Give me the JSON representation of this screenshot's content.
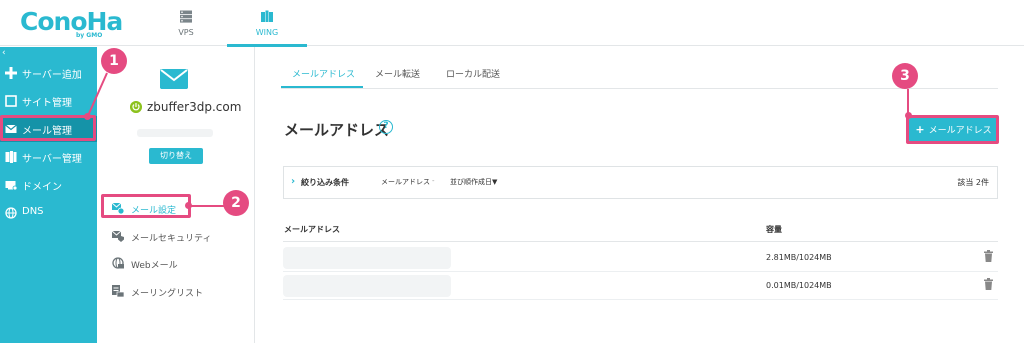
{
  "brand": {
    "logo_text": "ConoHa",
    "logo_sub": "by GMO"
  },
  "top_nav": [
    {
      "label": "VPS",
      "icon": "server-icon"
    },
    {
      "label": "WING",
      "icon": "wing-icon",
      "active": true
    }
  ],
  "sidebar": {
    "collapse_glyph": "‹",
    "items": [
      {
        "label": "サーバー追加",
        "icon": "plus-icon"
      },
      {
        "label": "サイト管理",
        "icon": "site-icon"
      },
      {
        "label": "メール管理",
        "icon": "mail-icon",
        "active": true
      },
      {
        "label": "サーバー管理",
        "icon": "server-manage-icon"
      },
      {
        "label": "ドメイン",
        "icon": "domain-icon"
      },
      {
        "label": "DNS",
        "icon": "globe-icon"
      }
    ]
  },
  "domain_panel": {
    "domain": "zbuffer3dp.com",
    "switch_label": "切り替え",
    "menu": [
      {
        "label": "メール設定",
        "icon": "mail-settings-icon",
        "active": true
      },
      {
        "label": "メールセキュリティ",
        "icon": "mail-security-icon"
      },
      {
        "label": "Webメール",
        "icon": "webmail-icon"
      },
      {
        "label": "メーリングリスト",
        "icon": "mailing-list-icon"
      }
    ]
  },
  "main": {
    "tabs": [
      {
        "label": "メールアドレス",
        "active": true
      },
      {
        "label": "メール転送"
      },
      {
        "label": "ローカル配送"
      }
    ],
    "title": "メールアドレス",
    "help_glyph": "?",
    "add_button": {
      "plus": "+",
      "label": "メールアドレス"
    },
    "filter": {
      "chevron": "›",
      "label": "絞り込み条件",
      "field": "メールアドレス",
      "field_dropdown": "-",
      "sort_label": "並び順",
      "sort_value": "作成日▼",
      "count": "該当 2件"
    },
    "columns": {
      "address": "メールアドレス",
      "capacity": "容量"
    },
    "rows": [
      {
        "capacity": "2.81MB/1024MB"
      },
      {
        "capacity": "0.01MB/1024MB"
      }
    ]
  },
  "annotations": [
    {
      "number": "1"
    },
    {
      "number": "2"
    },
    {
      "number": "3"
    }
  ],
  "colors": {
    "accent": "#2ab9d0",
    "sidebar_active": "#1593a8",
    "annotation": "#e54b81",
    "power_green": "#8dc21f"
  }
}
